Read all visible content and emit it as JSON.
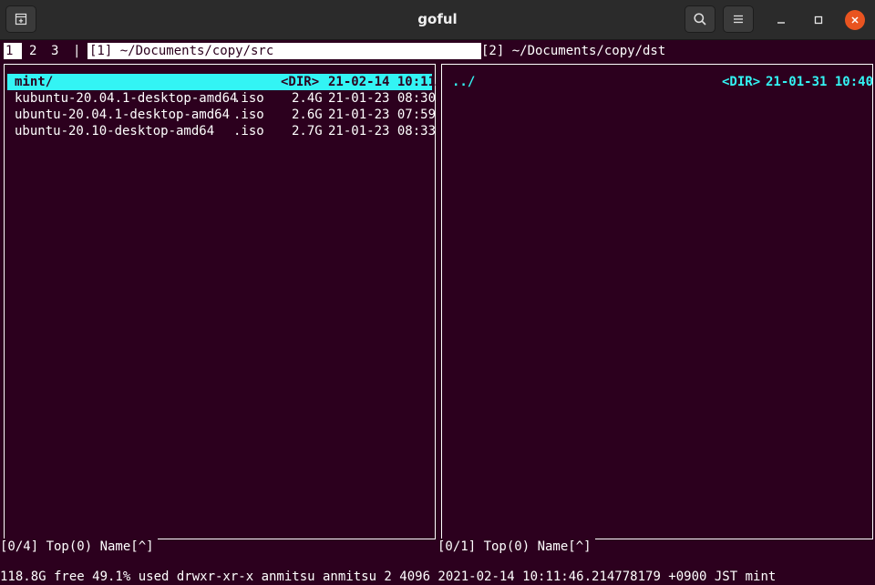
{
  "window": {
    "title": "goful",
    "icons": {
      "new_tab": "new-tab-icon",
      "search": "search-icon",
      "menu": "hamburger-menu-icon",
      "minimize": "minimize-icon",
      "maximize": "maximize-icon",
      "close": "close-icon"
    },
    "accent_close": "#e95420"
  },
  "tabs": {
    "items": [
      "1",
      "2",
      "3"
    ],
    "separator": "|",
    "active": "1"
  },
  "panes": [
    {
      "header": "[1] ~/Documents/copy/src",
      "entries": [
        {
          "name": "mint/",
          "ext": "",
          "size": "<DIR>",
          "date": "21-02-14 10:11",
          "type": "dir",
          "cursor": true
        },
        {
          "name": "kubuntu-20.04.1-desktop-amd64",
          "ext": ".iso",
          "size": "2.4G",
          "date": "21-01-23 08:30",
          "type": "file",
          "cursor": false
        },
        {
          "name": "ubuntu-20.04.1-desktop-amd64",
          "ext": ".iso",
          "size": "2.6G",
          "date": "21-01-23 07:59",
          "type": "file",
          "cursor": false
        },
        {
          "name": "ubuntu-20.10-desktop-amd64",
          "ext": ".iso",
          "size": "2.7G",
          "date": "21-01-23 08:33",
          "type": "file",
          "cursor": false
        }
      ],
      "status": "[0/4] Top(0) Name[^]"
    },
    {
      "header": "[2] ~/Documents/copy/dst",
      "entries": [
        {
          "name": "../",
          "ext": "",
          "size": "<DIR>",
          "date": "21-01-31 10:40",
          "type": "dir",
          "cursor": false
        }
      ],
      "status": "[0/1] Top(0) Name[^]"
    }
  ],
  "footer": "118.8G free 49.1% used drwxr-xr-x anmitsu anmitsu 2 4096 2021-02-14 10:11:46.214778179 +0900 JST mint",
  "colors": {
    "background": "#2c001e",
    "cursor_bg": "#33f4f4",
    "directory": "#33f4f4",
    "text": "#ffffff",
    "titlebar": "#2b2b2b"
  }
}
